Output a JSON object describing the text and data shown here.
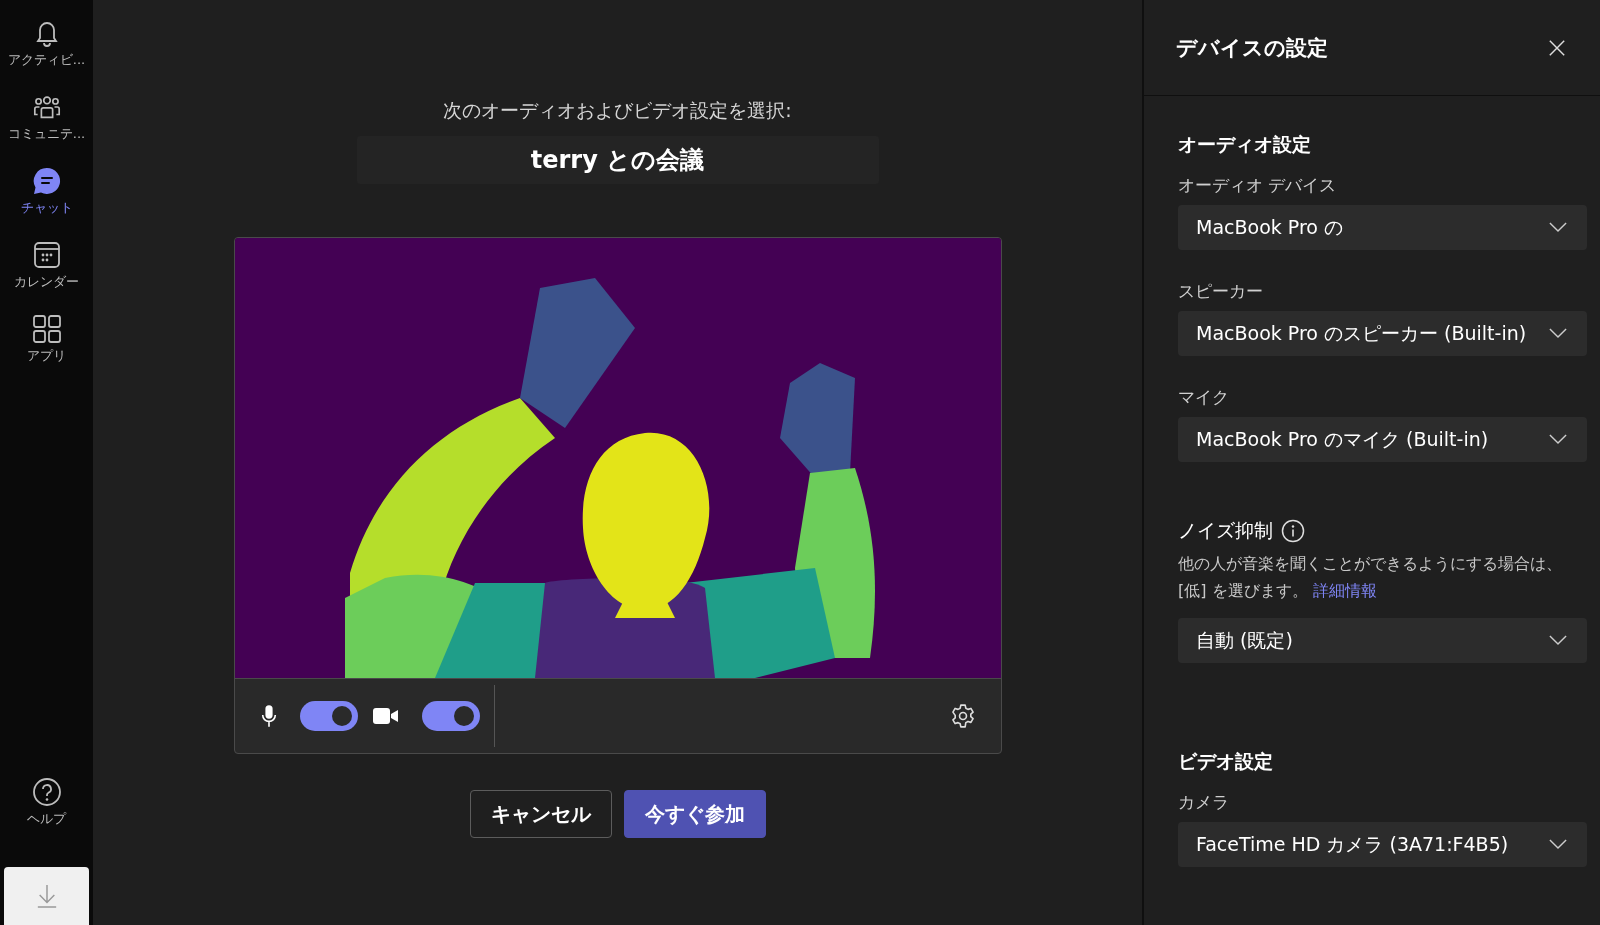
{
  "sidebar": {
    "items": [
      {
        "label": "アクティビ...",
        "selected": false
      },
      {
        "label": "コミュニテ...",
        "selected": false
      },
      {
        "label": "チャット",
        "selected": true
      },
      {
        "label": "カレンダー",
        "selected": false
      },
      {
        "label": "アプリ",
        "selected": false
      }
    ],
    "help": {
      "label": "ヘルプ"
    }
  },
  "prejoin": {
    "prompt": "次のオーディオおよびビデオ設定を選択:",
    "meeting_title": "terry との会議",
    "controls": {
      "mic_on": true,
      "camera_on": true
    },
    "buttons": [
      {
        "label": "キャンセル",
        "kind": "secondary"
      },
      {
        "label": "今すぐ参加",
        "kind": "primary"
      }
    ]
  },
  "panel": {
    "title": "デバイスの設定",
    "audio": {
      "heading": "オーディオ設定",
      "fields": [
        {
          "label": "オーディオ デバイス",
          "value": "MacBook Pro の"
        },
        {
          "label": "スピーカー",
          "value": "MacBook Pro のスピーカー (Built-in)"
        },
        {
          "label": "マイク",
          "value": "MacBook Pro のマイク (Built-in)"
        }
      ]
    },
    "noise": {
      "label": "ノイズ抑制",
      "description": "他の人が音楽を聞くことができるようにする場合は、[低] を選びます。",
      "link": "詳細情報",
      "value": "自動 (既定)"
    },
    "video": {
      "heading": "ビデオ設定",
      "fields": [
        {
          "label": "カメラ",
          "value": "FaceTime HD カメラ (3A71:F4B5)"
        }
      ]
    }
  }
}
